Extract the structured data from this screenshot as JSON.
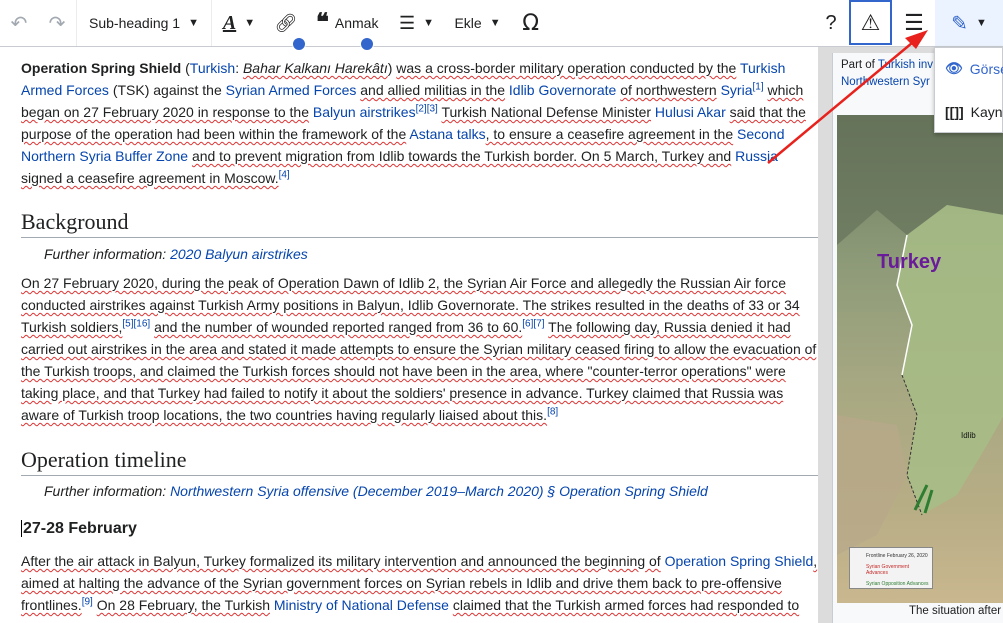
{
  "toolbar": {
    "heading_label": "Sub-heading 1",
    "cite_label": "Anmak",
    "insert_label": "Ekle",
    "help_label": "?",
    "omega": "Ω"
  },
  "edit_menu": {
    "visual_label": "Görsel",
    "source_label": "Kaynak"
  },
  "article": {
    "lead": {
      "title_bold": "Operation Spring Shield",
      "turkish_link": "Turkish",
      "turkish_name": "Bahar Kalkanı Harekâtı",
      "t1": "was a cross-border military operation conducted by the",
      "taf_link": "Turkish Armed Forces",
      "t2": "(TSK) against the",
      "saf_link": "Syrian Armed Forces",
      "t3": "and allied militias in the",
      "idlib_gov_link": "Idlib Governorate",
      "t4": "of northwestern",
      "syria_link": "Syria",
      "ref1": "[1]",
      "t5": "which began on 27 February 2020 in response to the",
      "airstrikes_link": "Balyun airstrikes",
      "ref23": "[2][3]",
      "t6": "Turkish National Defense Minister",
      "akar_link": "Hulusi Akar",
      "t7": "said that the purpose of the operation had been within the framework of the",
      "astana_link": "Astana talks",
      "t8": ", to ensure a ceasefire agreement in the",
      "buffer_link": "Second Northern Syria Buffer Zone",
      "t9": "and to prevent migration from Idlib towards the Turkish border. On 5 March, Turkey and",
      "russia_link": "Russia",
      "t10": "signed a ceasefire agreement in Moscow.",
      "ref4": "[4]"
    },
    "background": {
      "heading": "Background",
      "further_prefix": "Further information:",
      "further_link": "2020 Balyun airstrikes",
      "b1": "On 27 February 2020, during the peak of Operation Dawn of Idlib 2, the Syrian Air Force and allegedly the Russian Air force conducted airstrikes against Turkish Army positions in Balyun, Idlib Governorate. The strikes resulted in the deaths of 33 or 34 Turkish soldiers,",
      "ref516": "[5][16]",
      "b2": "and the number of wounded reported ranged from 36 to 60.",
      "ref67": "[6][7]",
      "b3": "The following day, Russia denied it had carried out airstrikes in the area and stated it made attempts to ensure the Syrian military ceased firing to allow the evacuation of the Turkish troops, and claimed the Turkish forces should not have been in the area, where \"counter-terror operations\" were taking place, and that Turkey had failed to notify it about the soldiers' presence in advance. Turkey claimed that Russia was aware of Turkish troop locations, the two countries having regularly liaised about this.",
      "ref8": "[8]"
    },
    "timeline": {
      "heading": "Operation timeline",
      "further_prefix": "Further information:",
      "further_link": "Northwestern Syria offensive (December 2019–March 2020) § Operation Spring Shield",
      "subheading": "27-28 February",
      "c1": "After the air attack in Balyun, Turkey formalized its military intervention and announced the beginning of",
      "oss_link": "Operation Spring Shield",
      "c2": ", aimed at halting the advance of the Syrian government forces on Syrian rebels in Idlib and drive them back   to pre-offensive frontlines.",
      "ref9": "[9]",
      "c3": "On 28 February, the Turkish",
      "ministry_link": "Ministry of National Defense",
      "c4": "claimed that the Turkish armed forces had responded to"
    }
  },
  "sidebar": {
    "part_prefix": "Part of",
    "part_link1": "Turkish inv",
    "part_link2": "Northwestern Syr",
    "map_label": "Turkey",
    "map_city": "Idlib",
    "caption": "The situation after th",
    "legend1": "Frontline February 26, 2020",
    "legend2": "Syrian Government Advances",
    "legend3": "Syrian Opposition Advances"
  },
  "colors": {
    "link": "#0645ad",
    "accent": "#3366cc",
    "annotation_arrow": "#e8211c"
  }
}
